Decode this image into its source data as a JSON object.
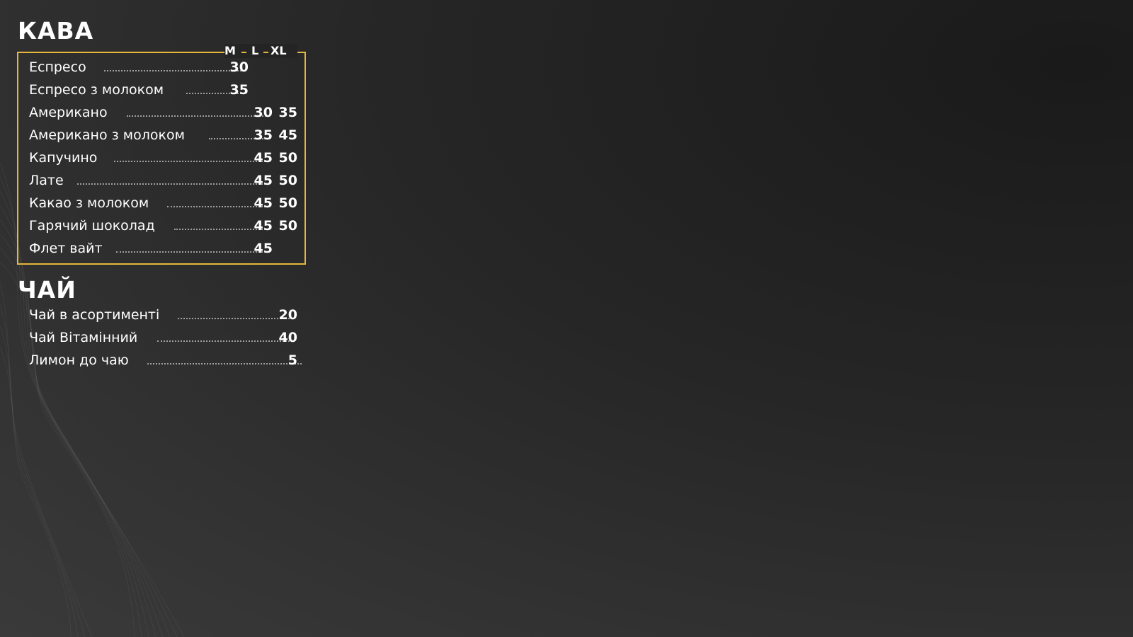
{
  "coffee": {
    "title": "КАВА",
    "sizes": [
      "M",
      "L",
      "XL"
    ],
    "items": [
      {
        "name": "Еспресо",
        "m": "30",
        "l": "",
        "xl": ""
      },
      {
        "name": "Еспресо з молоком",
        "m": "35",
        "l": "",
        "xl": ""
      },
      {
        "name": "Американо",
        "m": "",
        "l": "30",
        "xl": "35"
      },
      {
        "name": "Американо з молоком",
        "m": "",
        "l": "35",
        "xl": "45"
      },
      {
        "name": "Капучино",
        "m": "",
        "l": "45",
        "xl": "50"
      },
      {
        "name": "Лате",
        "m": "",
        "l": "45",
        "xl": "50"
      },
      {
        "name": "Какао з молоком",
        "m": "",
        "l": "45",
        "xl": "50"
      },
      {
        "name": "Гарячий шоколад",
        "m": "",
        "l": "45",
        "xl": "50"
      },
      {
        "name": "Флет вайт",
        "m": "",
        "l": "45",
        "xl": ""
      }
    ]
  },
  "tea": {
    "title": "ЧАЙ",
    "items": [
      {
        "name": "Чай в асортименті",
        "price": "20"
      },
      {
        "name": "Чай Вітамінний",
        "price": "40"
      },
      {
        "name": "Лимон до чаю",
        "price": "5"
      }
    ]
  },
  "colors": {
    "accent": "#e4b73d",
    "text": "#ffffff",
    "background": "#262626"
  }
}
